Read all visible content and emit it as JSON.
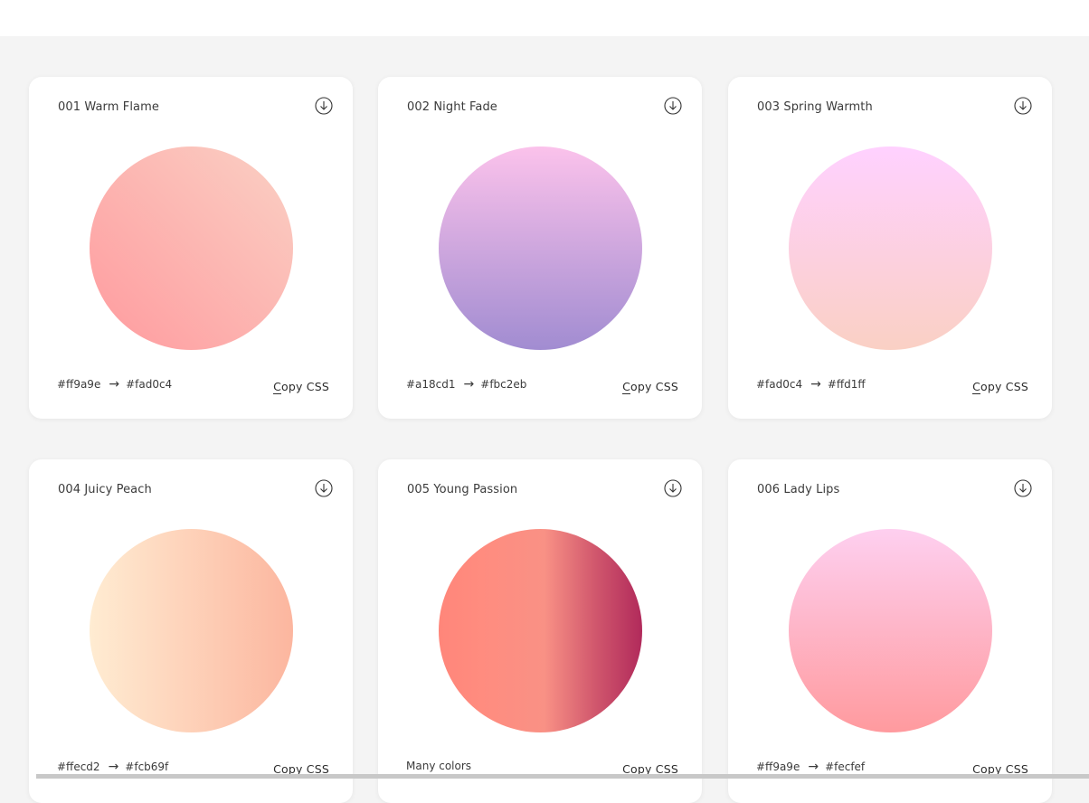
{
  "cards": [
    {
      "title": "001 Warm Flame",
      "from": "#ff9a9e",
      "to": "#fad0c4",
      "copy_label_first": "C",
      "copy_label_rest": "opy CSS",
      "gradient": "linear-gradient(45deg, #ff9a9e 0%, #fad0c4 99%, #fad0c4 100%)"
    },
    {
      "title": "002 Night Fade",
      "from": "#a18cd1",
      "to": "#fbc2eb",
      "copy_label_first": "C",
      "copy_label_rest": "opy CSS",
      "gradient": "linear-gradient(to top, #a18cd1 0%, #fbc2eb 100%)"
    },
    {
      "title": "003 Spring Warmth",
      "from": "#fad0c4",
      "to": "#ffd1ff",
      "copy_label_first": "C",
      "copy_label_rest": "opy CSS",
      "gradient": "linear-gradient(to top, #fad0c4 0%, #ffd1ff 100%)"
    },
    {
      "title": "004 Juicy Peach",
      "from": "#ffecd2",
      "to": "#fcb69f",
      "copy_label_first": "C",
      "copy_label_rest": "opy CSS",
      "gradient": "linear-gradient(to right, #ffecd2 0%, #fcb69f 100%)"
    },
    {
      "title": "005 Young Passion",
      "many_colors": "Many colors",
      "copy_label_first": "C",
      "copy_label_rest": "opy CSS",
      "gradient": "linear-gradient(to right, #ff8177 0%, #ff867a 0%, #ff8c7f 21%, #f99185 52%, #cf556c 78%, #b12a5b 100%)"
    },
    {
      "title": "006 Lady Lips",
      "from": "#ff9a9e",
      "to": "#fecfef",
      "copy_label_first": "C",
      "copy_label_rest": "opy CSS",
      "gradient": "linear-gradient(to top, #ff9a9e 0%, #fecfef 99%, #fecfef 100%)"
    }
  ],
  "arrow": "→",
  "icons": {
    "download": "download-circle-icon"
  }
}
